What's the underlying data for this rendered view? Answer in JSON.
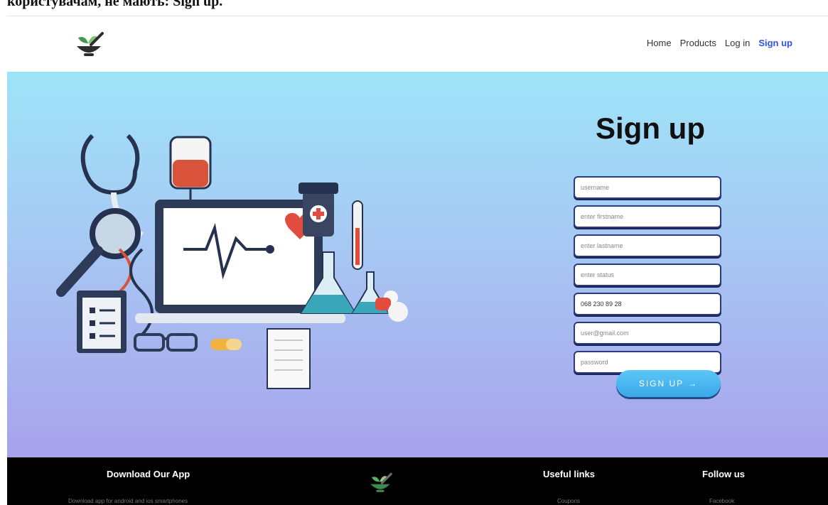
{
  "caption": "користувачам, не мають: Sign up.",
  "nav": {
    "links": [
      {
        "label": "Home",
        "active": false
      },
      {
        "label": "Products",
        "active": false
      },
      {
        "label": "Log in",
        "active": false
      },
      {
        "label": "Sign up",
        "active": true
      }
    ],
    "logo_icon": "mortar-pestle-leaf-logo"
  },
  "hero": {
    "illustration_icon": "medical-equipment-illustration",
    "title": "Sign up",
    "fields": [
      {
        "name": "username-field",
        "placeholder": "username",
        "value": ""
      },
      {
        "name": "firstname-field",
        "placeholder": "enter firstname",
        "value": ""
      },
      {
        "name": "lastname-field",
        "placeholder": "enter lastname",
        "value": ""
      },
      {
        "name": "status-field",
        "placeholder": "enter status",
        "value": ""
      },
      {
        "name": "phone-field",
        "placeholder": "",
        "value": "068 230 89 28"
      },
      {
        "name": "email-field",
        "placeholder": "user@gmail.com",
        "value": ""
      },
      {
        "name": "password-field",
        "placeholder": "password",
        "value": ""
      }
    ],
    "button_label": "SIGN UP",
    "button_arrow": "→"
  },
  "footer": {
    "app_heading": "Download Our App",
    "app_text": "Download app for android and ios smartphones",
    "links_heading": "Useful links",
    "links_item": "Coupons",
    "follow_heading": "Follow us",
    "follow_item": "Facebook"
  },
  "colors": {
    "accent": "#2f52e8",
    "hero_top": "#9ee4f8",
    "hero_bottom": "#a8a2eb",
    "button": "#3aa8ea",
    "footer_bg": "#000000"
  }
}
